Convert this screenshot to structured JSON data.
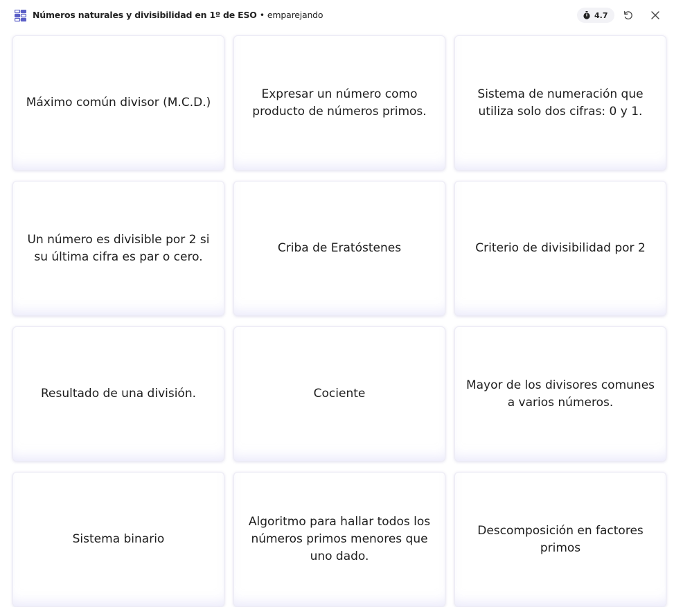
{
  "header": {
    "course": "Números naturales y divisibilidad en 1º de ESO",
    "separator": "•",
    "mode": "emparejando",
    "timer": "4.7"
  },
  "cards": [
    "Máximo común divisor (M.C.D.)",
    "Expresar un número como producto de números primos.",
    "Sistema de numeración que utiliza solo dos cifras: 0 y 1.",
    "Un número es divisible por 2 si su última cifra es par o cero.",
    "Criba de Eratóstenes",
    "Criterio de divisibilidad por 2",
    "Resultado de una división.",
    "Cociente",
    "Mayor de los divisores comunes a varios números.",
    "Sistema binario",
    "Algoritmo para hallar todos los números primos menores que uno dado.",
    "Descomposición en factores primos"
  ],
  "colors": {
    "accent": "#5b5fc7",
    "text": "#1e1e1e"
  },
  "icons": {
    "app": "cards-grid-icon",
    "timer": "stopwatch-icon",
    "restart": "restart-icon",
    "close": "close-icon"
  }
}
